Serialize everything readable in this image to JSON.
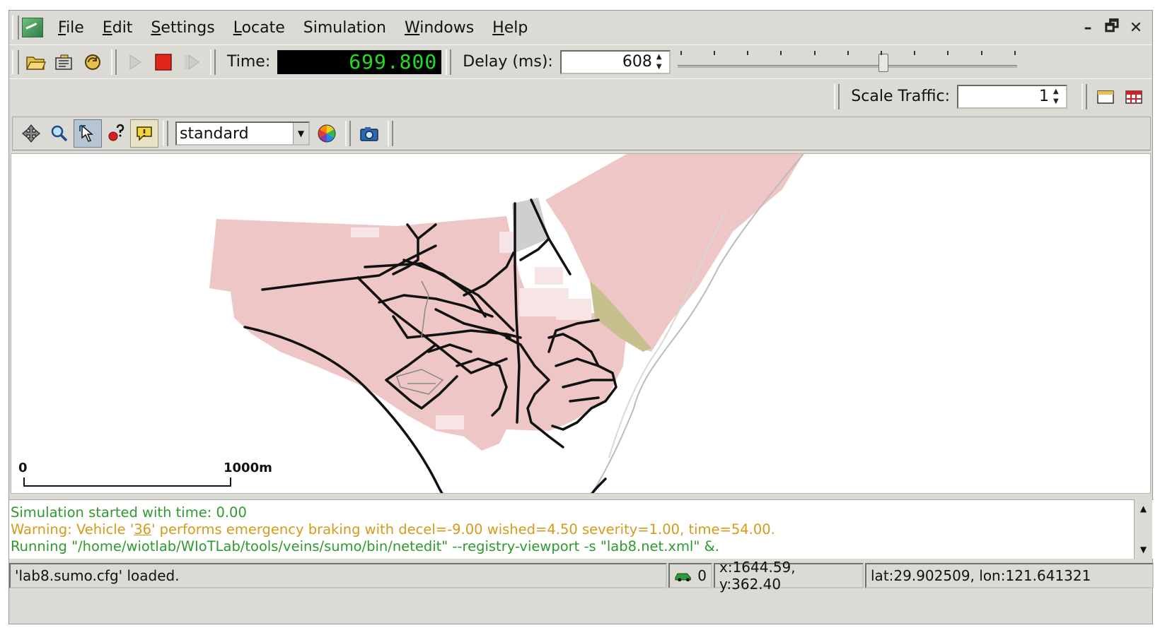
{
  "menubar": {
    "items": [
      {
        "label": "File",
        "mnemonic": "F",
        "rest": "ile"
      },
      {
        "label": "Edit",
        "mnemonic": "E",
        "rest": "dit"
      },
      {
        "label": "Settings",
        "mnemonic": "S",
        "rest": "ettings"
      },
      {
        "label": "Locate",
        "mnemonic": "L",
        "rest": "ocate"
      },
      {
        "label": "Simulation",
        "mnemonic": "",
        "rest": "Simulation"
      },
      {
        "label": "Windows",
        "mnemonic": "W",
        "rest": "indows"
      },
      {
        "label": "Help",
        "mnemonic": "H",
        "rest": "elp"
      }
    ],
    "controls": {
      "minimize": "–",
      "restore": "🗗",
      "close": "✕"
    }
  },
  "toolbar": {
    "time_label": "Time:",
    "time_value": "699.800",
    "delay_label": "Delay (ms):",
    "delay_value": "608",
    "delay_fraction": 0.61,
    "scale_label": "Scale Traffic:",
    "scale_value": "1"
  },
  "view_toolbar": {
    "scheme": "standard"
  },
  "map": {
    "scale_zero": "0",
    "scale_length": "1000m"
  },
  "log": {
    "line1": "Simulation started with time: 0.00",
    "line2_prefix": "Warning: Vehicle '",
    "line2_id": "36",
    "line2_suffix": "' performs emergency braking with decel=-9.00 wished=4.50 severity=1.00, time=54.00.",
    "line3": "Running \"/home/wiotlab/WIoTLab/tools/veins/sumo/bin/netedit\" --registry-viewport -s \"lab8.net.xml\" &."
  },
  "status": {
    "message": "'lab8.sumo.cfg' loaded.",
    "vehicle_count": "0",
    "xy": "x:1644.59, y:362.40",
    "latlon": "lat:29.902509, lon:121.641321"
  },
  "colors": {
    "land": "#eec6c6",
    "road": "#111111",
    "park": "#c5c08c",
    "time_fg": "#22dd22",
    "log_info": "#2e9a2e",
    "log_warn": "#d69a1a"
  }
}
